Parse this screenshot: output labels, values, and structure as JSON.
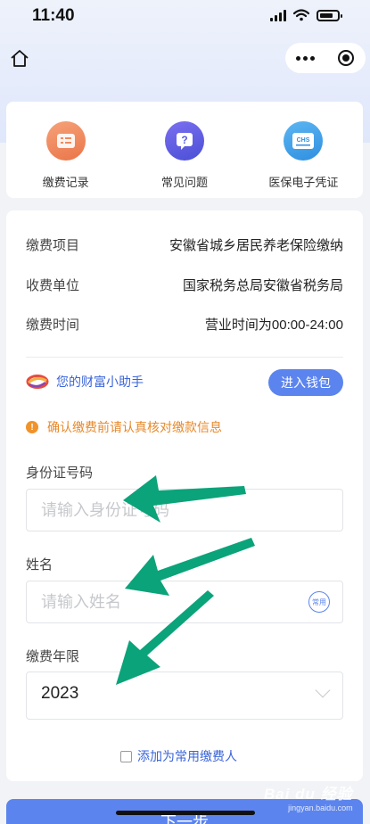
{
  "status_bar": {
    "time": "11:40"
  },
  "icons": {
    "home": "home-icon",
    "more": "more-icon",
    "close": "target-icon"
  },
  "quick_links": [
    {
      "label": "缴费记录",
      "icon": "payment-record-icon",
      "color": "#f08a5d"
    },
    {
      "label": "常见问题",
      "icon": "faq-icon",
      "color": "#5a5ce0"
    },
    {
      "label": "医保电子凭证",
      "icon": "medical-insurance-icon",
      "color": "#3aa0ea",
      "icon_text": "CHS"
    }
  ],
  "info": {
    "item_label": "缴费项目",
    "item_value": "安徽省城乡居民养老保险缴纳",
    "payee_label": "收费单位",
    "payee_value": "国家税务总局安徽省税务局",
    "time_label": "缴费时间",
    "time_value": "营业时间为00:00-24:00"
  },
  "assistant": {
    "label": "您的财富小助手",
    "button": "进入钱包"
  },
  "notice": {
    "icon_text": "!",
    "text": "确认缴费前请认真核对缴款信息"
  },
  "form": {
    "id_label": "身份证号码",
    "id_placeholder": "请输入身份证号码",
    "name_label": "姓名",
    "name_placeholder": "请输入姓名",
    "name_common_icon": "常用",
    "year_label": "缴费年限",
    "year_value": "2023",
    "add_common": "添加为常用缴费人"
  },
  "next_button": "下一步",
  "watermark": {
    "logo": "Bai du 经验",
    "url": "jingyan.baidu.com"
  },
  "colors": {
    "primary": "#5b84ee",
    "link": "#3a64d8",
    "warning": "#e8892a",
    "arrow": "#0ba37a"
  }
}
